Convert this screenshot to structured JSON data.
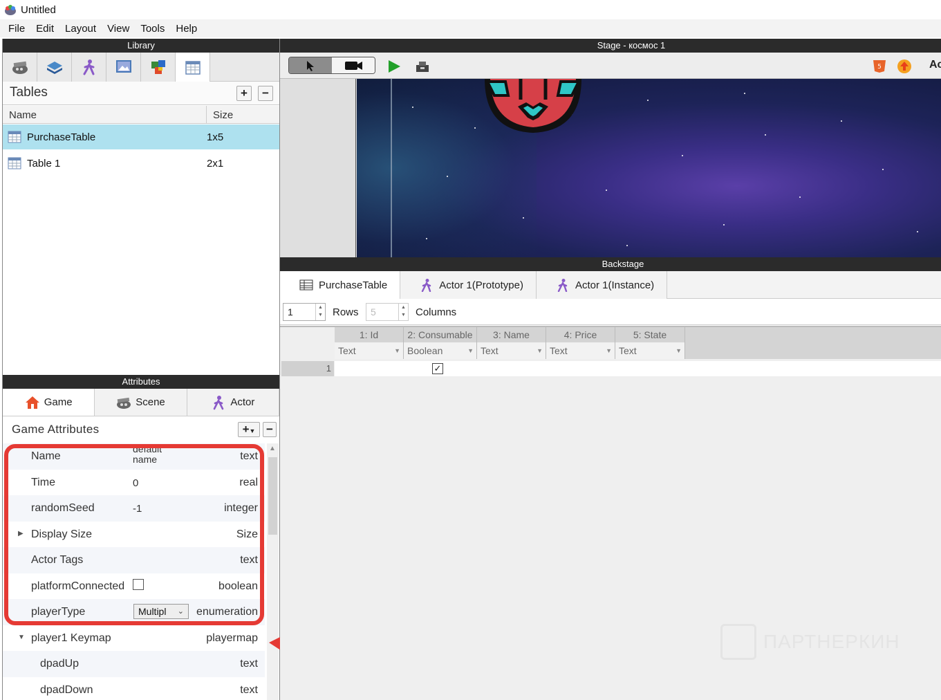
{
  "window": {
    "title": "Untitled"
  },
  "menu": [
    "File",
    "Edit",
    "Layout",
    "View",
    "Tools",
    "Help"
  ],
  "library": {
    "header": "Library",
    "section_title": "Tables",
    "add_label": "+",
    "remove_label": "−",
    "columns": {
      "name": "Name",
      "size": "Size"
    },
    "rows": [
      {
        "name": "PurchaseTable",
        "size": "1x5",
        "selected": true
      },
      {
        "name": "Table 1",
        "size": "2x1",
        "selected": false
      }
    ]
  },
  "attributes": {
    "header": "Attributes",
    "tabs": [
      "Game",
      "Scene",
      "Actor"
    ],
    "title": "Game Attributes",
    "add_label": "+",
    "remove_label": "−",
    "rows": [
      {
        "name": "Name",
        "value": "default name",
        "type": "text"
      },
      {
        "name": "Time",
        "value": "0",
        "type": "real"
      },
      {
        "name": "randomSeed",
        "value": "-1",
        "type": "integer"
      },
      {
        "name": "Display Size",
        "value": "",
        "type": "Size"
      },
      {
        "name": "Actor Tags",
        "value": "",
        "type": "text"
      },
      {
        "name": "platformConnected",
        "value": "",
        "type": "boolean"
      },
      {
        "name": "playerType",
        "value": "Multipl",
        "type": "enumeration"
      },
      {
        "name": "player1 Keymap",
        "value": "",
        "type": "playermap"
      },
      {
        "name": "dpadUp",
        "value": "",
        "type": "text"
      },
      {
        "name": "dpadDown",
        "value": "",
        "type": "text"
      }
    ]
  },
  "stage": {
    "header": "Stage - космос 1",
    "right_label": "Ac"
  },
  "backstage": {
    "header": "Backstage",
    "tabs": [
      "PurchaseTable",
      "Actor 1(Prototype)",
      "Actor 1(Instance)"
    ],
    "rows_value": "1",
    "rows_label": "Rows",
    "columns_value": "5",
    "columns_label": "Columns",
    "columns": [
      {
        "header": "1: Id",
        "type": "Text"
      },
      {
        "header": "2: Consumable",
        "type": "Boolean"
      },
      {
        "header": "3: Name",
        "type": "Text"
      },
      {
        "header": "4: Price",
        "type": "Text"
      },
      {
        "header": "5: State",
        "type": "Text"
      }
    ],
    "row_numbers": [
      "1"
    ],
    "checked_mark": "✓"
  },
  "watermark": {
    "text": "ПАРТНЕРКИН"
  },
  "colors": {
    "selection": "#aee1ef",
    "header_bg": "#2b2b2b",
    "highlight": "#e53a34"
  }
}
